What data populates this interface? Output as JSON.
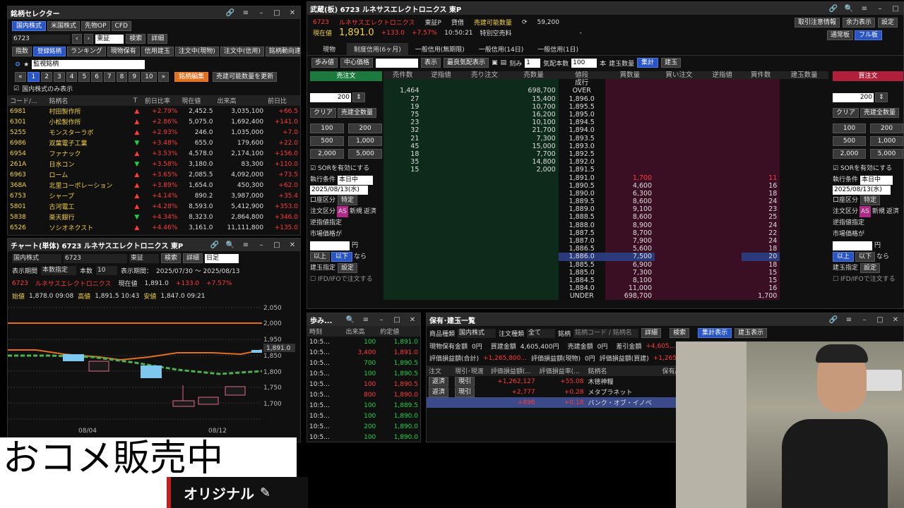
{
  "sel": {
    "title": "銘柄セレクター",
    "tabs": [
      "国内株式",
      "米国株式",
      "先物OP",
      "CFD"
    ],
    "code": "6723",
    "market": "東証",
    "search": "検索",
    "detail": "詳細",
    "subtabs": [
      "指数",
      "登録銘柄",
      "ランキング",
      "現物保有",
      "信用建玉",
      "注文中(現物)",
      "注文中(信用)",
      "銘柄動向速報"
    ],
    "list_name": "監視銘柄",
    "pages": [
      "1",
      "2",
      "3",
      "4",
      "5",
      "6",
      "7",
      "8",
      "9",
      "10"
    ],
    "edit": "銘柄編集",
    "refresh": "売建可能数量を更新",
    "only_domestic": "国内株式のみ表示",
    "cols": [
      "コード/...",
      "銘柄名",
      "T",
      "前日比率",
      "現在値",
      "出来高",
      "前日比"
    ],
    "rows": [
      [
        "6981",
        "村田製作所",
        "▲",
        "+2.79%",
        "2,452.5",
        "3,035,100",
        "+66.5"
      ],
      [
        "6301",
        "小松製作所",
        "▲",
        "+2.86%",
        "5,075.0",
        "1,692,400",
        "+141.0"
      ],
      [
        "5255",
        "モンスターラボ",
        "▲",
        "+2.93%",
        "246.0",
        "1,035,000",
        "+7.0"
      ],
      [
        "6986",
        "双葉電子工業",
        "▼",
        "+3.48%",
        "655.0",
        "179,600",
        "+22.0"
      ],
      [
        "6954",
        "ファナック",
        "▲",
        "+3.53%",
        "4,578.0",
        "2,174,100",
        "+156.0"
      ],
      [
        "261A",
        "日水コン",
        "▼",
        "+3.58%",
        "3,180.0",
        "83,300",
        "+110.0"
      ],
      [
        "6963",
        "ローム",
        "▲",
        "+3.65%",
        "2,085.5",
        "4,092,000",
        "+73.5"
      ],
      [
        "368A",
        "北里コーポレーション",
        "▲",
        "+3.89%",
        "1,654.0",
        "450,300",
        "+62.0"
      ],
      [
        "6753",
        "シャープ",
        "▲",
        "+4.14%",
        "890.2",
        "3,987,000",
        "+35.4"
      ],
      [
        "5801",
        "古河電工",
        "▲",
        "+4.28%",
        "8,593.0",
        "5,412,900",
        "+353.0"
      ],
      [
        "5838",
        "楽天銀行",
        "▼",
        "+4.34%",
        "8,323.0",
        "2,864,800",
        "+346.0"
      ],
      [
        "6526",
        "ソシオネクスト",
        "▲",
        "+4.46%",
        "3,161.0",
        "11,111,800",
        "+135.0"
      ]
    ]
  },
  "chart": {
    "title": "チャート(単体) 6723 ルネサスエレクトロニクス 東P",
    "market": "国内株式",
    "code": "6723",
    "exch": "東証",
    "search": "検索",
    "detail": "詳細",
    "period": "日足",
    "disp_label": "表示期間",
    "disp_val": "本数指定",
    "count_label": "本数",
    "count": "10",
    "range_label": "表示期間：",
    "range": "2025/07/30 ～ 2025/08/13",
    "code2": "6723",
    "name": "ルネサスエレクトロニクス",
    "cur_label": "現在値",
    "cur": "1,891.0",
    "chg": "+133.0",
    "chgp": "+7.57%",
    "open_l": "始値",
    "open": "1,878.0 09:08",
    "high_l": "高値",
    "high": "1,891.5 10:43",
    "low_l": "安値",
    "low": "1,847.0 09:21",
    "yticks": [
      "2,050",
      "2,000",
      "1,950",
      "1,900",
      "1,850",
      "1,800",
      "1,750",
      "1,700"
    ],
    "last_tag": "1,891.0",
    "xticks": [
      "08/04",
      "08/12"
    ]
  },
  "board": {
    "title": "武蔵(板) 6723 ルネサスエレクトロニクス 東P",
    "code": "6723",
    "name": "ルネサスエレクトロニクス",
    "exch": "東証P",
    "credit": "貸借",
    "sellable": "売建可能数量",
    "sellable_val": "59,200",
    "price_label": "現在値",
    "price": "1,891.0",
    "chg": "+133.0",
    "chgp": "+7.57%",
    "time": "10:50:21",
    "special": "特別空売料",
    "dash": "-",
    "topbtn": [
      "取引注意情報",
      "余力表示",
      "設定"
    ],
    "view": [
      "通常板",
      "フル板"
    ],
    "tabs": [
      "現物",
      "制度信用(6ヶ月)",
      "一般信用(無期限)",
      "一般信用(14日)",
      "一般信用(1日)"
    ],
    "tools": [
      "歩み値",
      "中心価格",
      "表示",
      "最良気配表示",
      "刻み",
      "気配本数",
      "本",
      "建玉数量",
      "集計",
      "建玉"
    ],
    "kizami": "1",
    "honsu": "100",
    "sell_btn": "売注文",
    "buy_btn": "買注文",
    "cols": [
      "売件数",
      "逆指値",
      "売り注文",
      "売数量",
      "値段",
      "買数量",
      "買い注文",
      "逆指値",
      "買件数",
      "建玉数量"
    ],
    "over": "OVER",
    "over_qty": "698,700",
    "over_cnt": "1,464",
    "under": "UNDER",
    "under_qty": "698,700",
    "under_cnt": "1,700",
    "nariyuki": "成行",
    "asks": [
      [
        "27",
        "15,400",
        "1,896.0"
      ],
      [
        "19",
        "10,700",
        "1,895.5"
      ],
      [
        "75",
        "16,200",
        "1,895.0"
      ],
      [
        "23",
        "10,100",
        "1,894.5"
      ],
      [
        "32",
        "21,700",
        "1,894.0"
      ],
      [
        "21",
        "7,300",
        "1,893.5"
      ],
      [
        "45",
        "15,000",
        "1,893.0"
      ],
      [
        "18",
        "7,700",
        "1,892.5"
      ],
      [
        "35",
        "14,800",
        "1,892.0"
      ],
      [
        "15",
        "2,000",
        "1,891.5"
      ]
    ],
    "bids": [
      [
        "1,891.0",
        "1,700",
        "11"
      ],
      [
        "1,890.5",
        "4,600",
        "16"
      ],
      [
        "1,890.0",
        "6,300",
        "18"
      ],
      [
        "1,889.5",
        "8,600",
        "24"
      ],
      [
        "1,889.0",
        "9,100",
        "23"
      ],
      [
        "1,888.5",
        "8,600",
        "25"
      ],
      [
        "1,888.0",
        "8,900",
        "24"
      ],
      [
        "1,887.5",
        "8,700",
        "22"
      ],
      [
        "1,887.0",
        "7,900",
        "24"
      ],
      [
        "1,886.5",
        "5,600",
        "18"
      ],
      [
        "1,886.0",
        "7,500",
        "20"
      ],
      [
        "1,885.5",
        "6,900",
        "18"
      ],
      [
        "1,885.0",
        "7,300",
        "15"
      ],
      [
        "1,884.5",
        "8,100",
        "15"
      ],
      [
        "1,884.0",
        "11,000",
        "16"
      ]
    ],
    "side": {
      "qty": "200",
      "clear": "クリア",
      "all": "売建全数量",
      "all_b": "売建全数量",
      "q": [
        "100",
        "200",
        "500",
        "1,000",
        "2,000",
        "5,000"
      ],
      "sor": "SORを有効にする",
      "exec": "執行条件",
      "exec_v": "本日中",
      "date": "2025/08/13(水)",
      "acct": "口座区分",
      "acct_v": "特定",
      "ord": "注文区分",
      "as": "AS",
      "new": "新規",
      "close": "返済",
      "stop": "逆指値指定",
      "mkt": "市場価格が",
      "yen": "円",
      "above": "以上",
      "below": "以下",
      "nara": "なら",
      "pos": "建玉指定",
      "set": "設定",
      "ifd": "IFD/IFOで注文する"
    }
  },
  "ticks": {
    "title": "歩み...",
    "cols": [
      "時刻",
      "出来高",
      "約定値"
    ],
    "rows": [
      [
        "10:5...",
        "100",
        "1,891.0",
        "g"
      ],
      [
        "10:5...",
        "3,400",
        "1,891.0",
        "r"
      ],
      [
        "10:5...",
        "700",
        "1,890.5",
        "g"
      ],
      [
        "10:5...",
        "100",
        "1,890.5",
        "g"
      ],
      [
        "10:5...",
        "100",
        "1,890.5",
        "r"
      ],
      [
        "10:5...",
        "800",
        "1,890.0",
        "r"
      ],
      [
        "10:5...",
        "100",
        "1,889.5",
        "g"
      ],
      [
        "10:5...",
        "100",
        "1,890.0",
        "g"
      ],
      [
        "10:5...",
        "200",
        "1,890.0",
        "g"
      ],
      [
        "10:5...",
        "100",
        "1,890.0",
        "g"
      ]
    ]
  },
  "hold": {
    "title": "保有･建玉一覧",
    "kind_l": "商品種類",
    "kind": "国内株式",
    "order_l": "注文種類",
    "order": "全て",
    "sym_l": "銘柄",
    "sym_ph": "銘柄コード / 銘柄名",
    "detail": "詳細",
    "search": "検索",
    "agg": "集計表示",
    "pos": "建玉表示",
    "l1": "現物保有金額",
    "l1v": "0円",
    "l2": "買建金額",
    "l2v": "4,605,400円",
    "l3": "売建金額",
    "l3v": "0円",
    "l4": "差引金額",
    "l4v": "+4,605,...",
    "m1": "評価損益額(合計)",
    "m1v": "+1,265,800...",
    "m2": "評価損益額(現物)",
    "m2v": "0円",
    "m3": "評価損益額(買建)",
    "m3v": "+1,265,800...",
    "cols": [
      "注文",
      "現引･現渡",
      "評価損益額(...",
      "評価損益率(...",
      "銘柄名",
      "保有/"
    ],
    "rows": [
      [
        "返済",
        "現引",
        "+1,262,127",
        "+55.08",
        "木徳神糧"
      ],
      [
        "返済",
        "現引",
        "+2,777",
        "+0.28",
        "メタプラネット"
      ],
      [
        "",
        "",
        "+896",
        "+0.18",
        "バンク・オブ・イノベ"
      ]
    ]
  },
  "overlay": {
    "text": "おコメ販売中",
    "sub": "オリジナル"
  },
  "colors": {
    "up": "#ff3b3b",
    "down": "#19d34a",
    "accent": "#2a55c5"
  }
}
